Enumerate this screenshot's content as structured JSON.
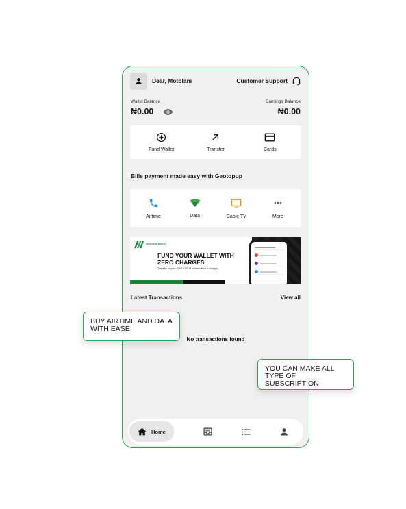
{
  "header": {
    "greeting": "Dear, Motolani",
    "support_label": "Customer Support"
  },
  "balances": {
    "wallet_label": "Wallet Balance",
    "wallet_amount": "₦0.00",
    "earnings_label": "Earnings Balance",
    "earnings_amount": "₦0.00"
  },
  "actions": [
    {
      "label": "Fund Wallet",
      "icon": "add-circle-icon"
    },
    {
      "label": "Transfer",
      "icon": "arrow-up-right-icon"
    },
    {
      "label": "Cards",
      "icon": "card-icon"
    }
  ],
  "bills_title": "Bills payment made easy with Geotopup",
  "bills": [
    {
      "label": "Airtime",
      "icon": "phone-icon",
      "color": "#1e88e5"
    },
    {
      "label": "Data",
      "icon": "wifi-icon",
      "color": "#43a047"
    },
    {
      "label": "Cable TV",
      "icon": "tv-icon",
      "color": "#fb8c00"
    },
    {
      "label": "More",
      "icon": "more-icon",
      "color": "#222222"
    }
  ],
  "banner": {
    "logo_text": "GEOTOPUP WALLET",
    "headline_1": "FUND YOUR WALLET WITH",
    "headline_2": "ZERO CHARGES",
    "subtext": "Transfer to your GEOTOPUP Wallet without charges"
  },
  "transactions": {
    "title": "Latest Transactions",
    "view_all": "View all",
    "empty_text": "No transactions found"
  },
  "nav": {
    "home_label": "Home"
  },
  "callouts": {
    "airtime": "BUY AIRTIME AND DATA WITH EASE",
    "subscription": "YOU CAN MAKE ALL TYPE OF SUBSCRIPTION"
  },
  "colors": {
    "brand_green": "#2ba84a",
    "dark_green": "#1f7f3b"
  }
}
